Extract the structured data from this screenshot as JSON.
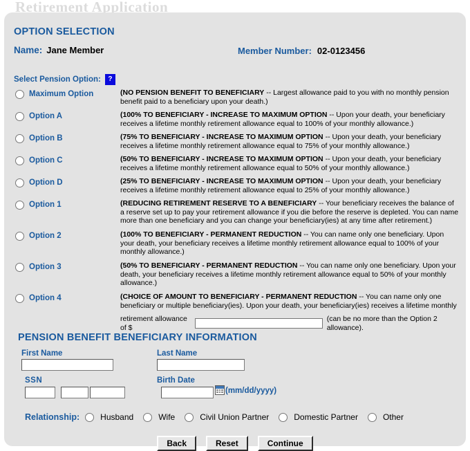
{
  "page": {
    "watermark_title": "Retirement Application"
  },
  "header": {
    "section_title": "OPTION SELECTION",
    "name_label": "Name:",
    "name_value": "Jane Member",
    "member_number_label": "Member Number:",
    "member_number_value": "02-0123456",
    "select_pension_label": "Select Pension Option:",
    "help_icon_text": "?"
  },
  "colors": {
    "heading_blue": "#1a5a9e",
    "help_icon_blue": "#0b0bdc",
    "panel_gray": "#e3e3e3",
    "watermark_gray": "#dcdcdc"
  },
  "options": [
    {
      "label": "Maximum Option",
      "title": "(NO PENSION BENEFIT TO BENEFICIARY",
      "body": " -- Largest allowance paid to you with no monthly pension benefit paid to a beneficiary upon your death.)"
    },
    {
      "label": "Option A",
      "title": "(100% TO BENEFICIARY - INCREASE TO MAXIMUM OPTION",
      "body": " -- Upon your death, your beneficiary receives a lifetime monthly retirement allowance equal to 100% of your monthly allowance.)"
    },
    {
      "label": "Option B",
      "title": "(75% TO BENEFICIARY - INCREASE TO MAXIMUM OPTION",
      "body": " -- Upon your death, your beneficiary receives a lifetime monthly retirement allowance equal to 75% of your monthly allowance.)"
    },
    {
      "label": "Option C",
      "title": "(50% TO BENEFICIARY - INCREASE TO MAXIMUM OPTION",
      "body": " -- Upon your death, your beneficiary receives a lifetime monthly retirement allowance equal to 50% of your monthly allowance.)"
    },
    {
      "label": "Option D",
      "title": "(25% TO BENEFICIARY - INCREASE TO MAXIMUM OPTION",
      "body": " -- Upon your death, your beneficiary receives a lifetime monthly retirement allowance equal to 25% of your monthly allowance.)"
    },
    {
      "label": "Option 1",
      "title": "(REDUCING RETIREMENT RESERVE TO A BENEFICIARY",
      "body": " -- Your beneficiary receives the balance of a reserve set up to pay your retirement allowance if you die before the reserve is depleted. You can name more than one beneficiary and you can change your beneficiary(ies) at any time after retirement.)"
    },
    {
      "label": "Option 2",
      "title": "(100% TO BENEFICIARY - PERMANENT REDUCTION",
      "body": " -- You can name only one beneficiary. Upon your death, your beneficiary receives a lifetime monthly retirement allowance equal to 100% of your monthly allowance.)"
    },
    {
      "label": "Option 3",
      "title": "(50% TO BENEFICIARY - PERMANENT REDUCTION",
      "body": " -- You can name only one beneficiary. Upon your death, your beneficiary receives a lifetime monthly retirement allowance equal to 50% of your monthly allowance.)"
    },
    {
      "label": "Option 4",
      "title": "(CHOICE OF AMOUNT TO BENEFICIARY - PERMANENT REDUCTION",
      "body": " -- You can name only one beneficiary or multiple beneficiary(ies). Upon your death, your beneficiary(ies) receives a lifetime monthly"
    }
  ],
  "option4_amount": {
    "prefix": "retirement allowance of $",
    "value": "",
    "suffix": "(can be no more than the Option 2 allowance)."
  },
  "beneficiary": {
    "heading": "PENSION BENEFIT BENEFICIARY INFORMATION",
    "first_name_label": "First Name",
    "first_name_value": "",
    "last_name_label": "Last Name",
    "last_name_value": "",
    "ssn_label": "SSN",
    "ssn_part1": "",
    "ssn_part2": "",
    "ssn_part3": "",
    "birth_date_label": "Birth Date",
    "birth_date_value": "",
    "date_format_hint": "(mm/dd/yyyy)",
    "relationship_label": "Relationship:",
    "relationship_options": [
      "Husband",
      "Wife",
      "Civil Union Partner",
      "Domestic Partner",
      "Other"
    ]
  },
  "buttons": {
    "back": "Back",
    "reset": "Reset",
    "continue": "Continue"
  }
}
